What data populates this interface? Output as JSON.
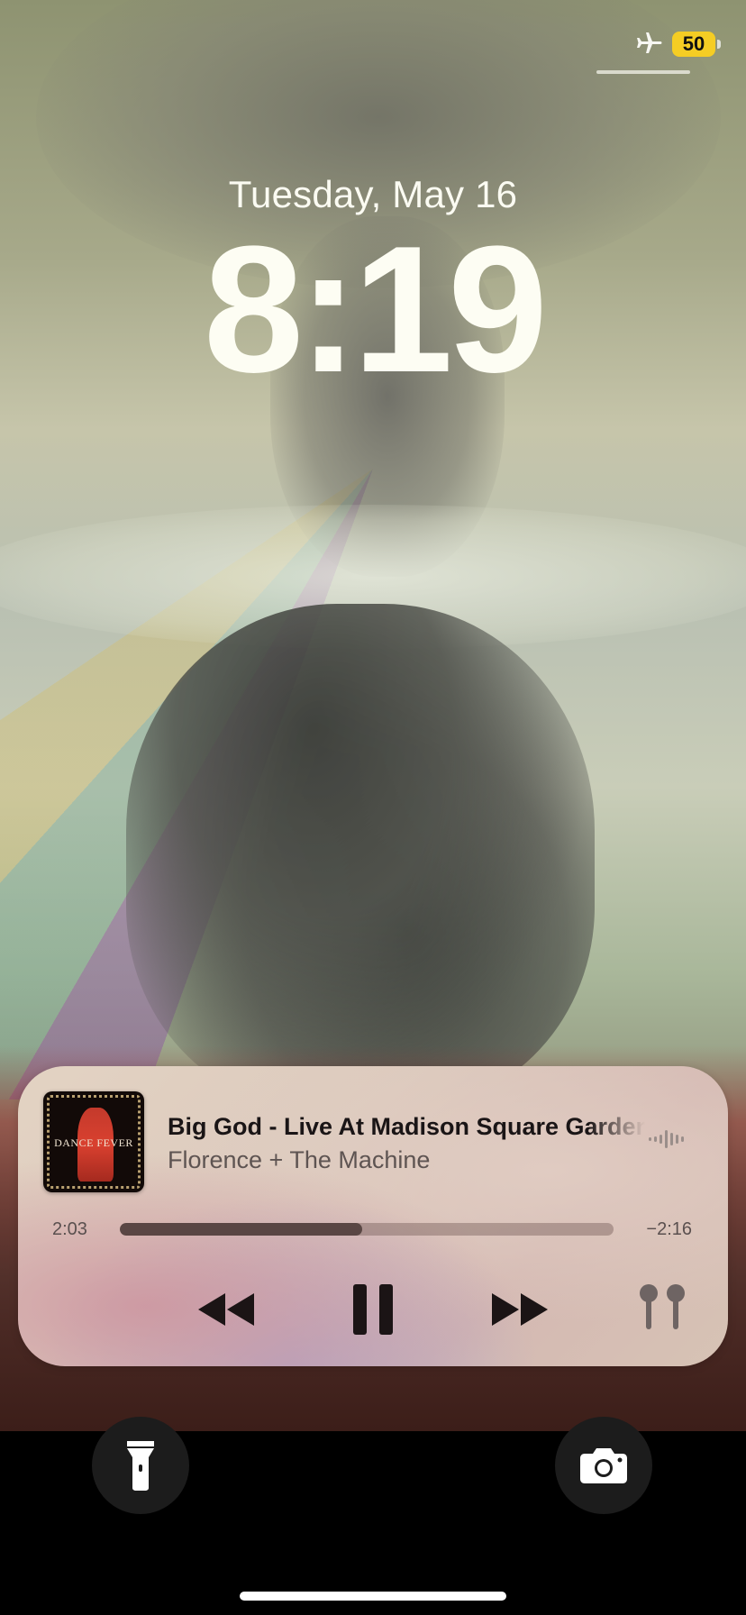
{
  "status_bar": {
    "airplane_mode_icon": "airplane-icon",
    "battery_level": "50",
    "battery_color": "#f5cd24"
  },
  "lock_screen": {
    "date": "Tuesday, May 16",
    "time": "8:19"
  },
  "now_playing": {
    "artwork_text": "DANCE FEVER",
    "title": "Big God - Live At Madison Square Garden",
    "artist": "Florence + The Machine",
    "elapsed": "2:03",
    "remaining": "−2:16",
    "progress": 0.49,
    "icons": {
      "waveform": "waveform-icon",
      "rewind": "rewind-icon",
      "pause": "pause-icon",
      "forward": "fast-forward-icon",
      "output": "airpods-icon"
    }
  },
  "quick_actions": {
    "flashlight_icon": "flashlight-icon",
    "camera_icon": "camera-icon"
  }
}
